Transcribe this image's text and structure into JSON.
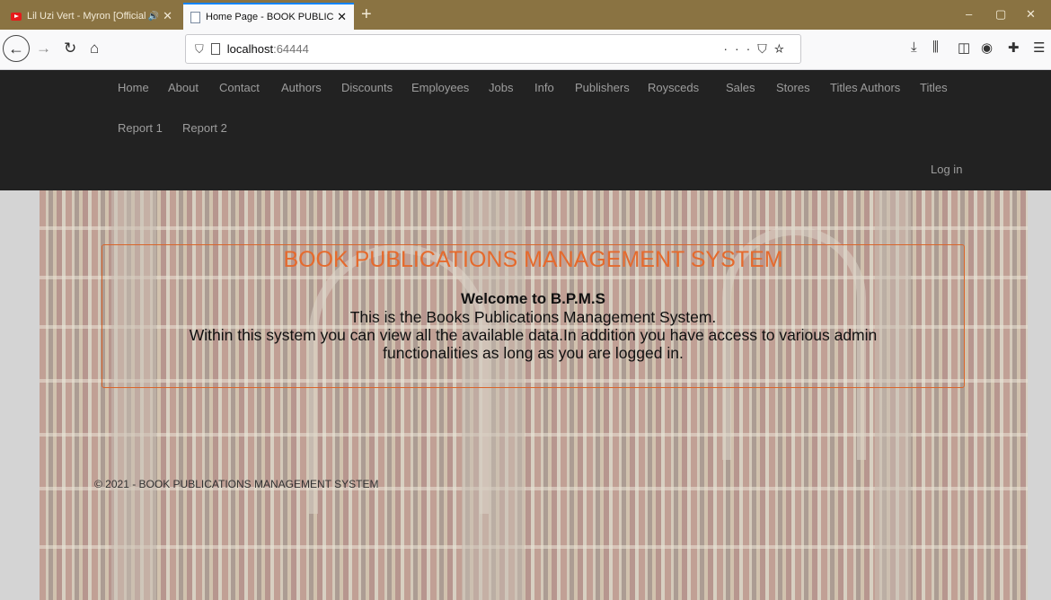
{
  "browser": {
    "tabs": [
      {
        "title": "Lil Uzi Vert - Myron [Official",
        "icon": "youtube-icon",
        "audio": true
      },
      {
        "title": "Home Page - BOOK PUBLICATI",
        "icon": "page-icon",
        "active": true
      }
    ],
    "new_tab": "+",
    "url": {
      "host": "localhost",
      "port": ":64444"
    },
    "window_controls": {
      "minimize": "–",
      "maximize": "▢",
      "close": "✕"
    },
    "accent": "#0a84ff"
  },
  "site": {
    "nav": [
      {
        "label": "Home"
      },
      {
        "label": "About"
      },
      {
        "label": "Contact"
      },
      {
        "label": "Authors"
      },
      {
        "label": "Discounts"
      },
      {
        "label": "Employees"
      },
      {
        "label": "Jobs"
      },
      {
        "label": "Info"
      },
      {
        "label": "Publishers"
      },
      {
        "label": "Roysceds"
      },
      {
        "label": "Sales"
      },
      {
        "label": "Stores"
      },
      {
        "label": "Titles Authors"
      },
      {
        "label": "Titles"
      },
      {
        "label": "Report 1"
      },
      {
        "label": "Report 2"
      }
    ],
    "login": "Log in",
    "colors": {
      "header_bg": "#222222",
      "nav_text": "#9d9d9d",
      "title": "#e56a2d"
    }
  },
  "hero": {
    "title": "BOOK PUBLICATIONS MANAGEMENT SYSTEM",
    "welcome": "Welcome to B.P.M.S",
    "line1": "This is the Books Publications Management System.",
    "line2": "Within this system you can view all the available data.In addition you have access to various admin",
    "line3": "functionalities as long as you are logged in."
  },
  "footer": {
    "text": "© 2021 - BOOK PUBLICATIONS MANAGEMENT SYSTEM"
  }
}
